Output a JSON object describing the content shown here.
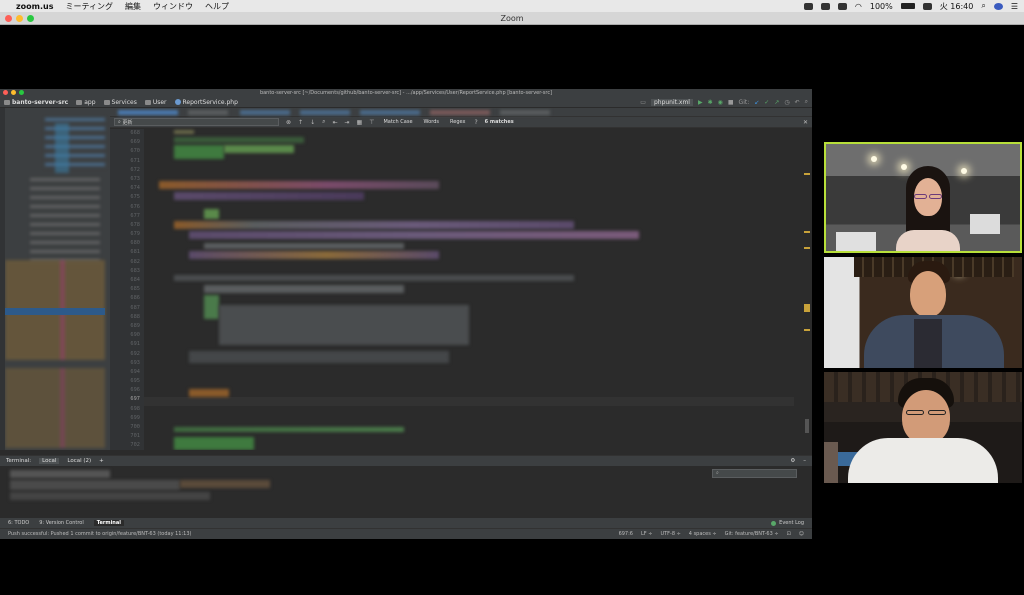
{
  "menubar": {
    "app_name": "zoom.us",
    "items": [
      "ミーティング",
      "編集",
      "ウィンドウ",
      "ヘルプ"
    ],
    "battery": "100%",
    "clock": "火 16:40"
  },
  "zoom_window": {
    "title": "Zoom"
  },
  "ide": {
    "window_title": "banto-server-src [~/Documents/github/banto-server-src] - .../app/Services/User/ReportService.php [banto-server-src]",
    "breadcrumbs": [
      "banto-server-src",
      "app",
      "Services",
      "User",
      "ReportService.php"
    ],
    "run_config": "phpunit.xml",
    "git_label": "Git:",
    "find": {
      "query": "更新",
      "match_case": "Match Case",
      "words": "Words",
      "regex": "Regex",
      "matches": "6 matches"
    },
    "line_numbers": [
      "668",
      "669",
      "670",
      "671",
      "672",
      "673",
      "674",
      "675",
      "676",
      "677",
      "678",
      "679",
      "680",
      "681",
      "682",
      "683",
      "684",
      "685",
      "686",
      "687",
      "688",
      "689",
      "690",
      "691",
      "692",
      "693",
      "694",
      "695",
      "696",
      "697",
      "698",
      "699",
      "700",
      "701",
      "702",
      "703",
      "704",
      "705"
    ],
    "current_line": "697",
    "terminal": {
      "label": "Terminal:",
      "tabs": [
        "Local",
        "Local (2)"
      ],
      "add": "+"
    },
    "tool_windows": {
      "todo": "6: TODO",
      "vcs": "9: Version Control",
      "terminal": "Terminal",
      "event_log": "Event Log"
    },
    "status": {
      "message": "Push successful: Pushed 1 commit to origin/feature/BNT-63 (today 11:13)",
      "position": "697:6",
      "line_sep": "LF ÷",
      "encoding": "UTF-8 ÷",
      "indent": "4 spaces ÷",
      "branch": "Git: feature/BNT-63 ÷"
    }
  },
  "colors": {
    "active_speaker_border": "#b8df3a",
    "ide_bg": "#2b2b2b",
    "ide_panel": "#3c3f41"
  }
}
